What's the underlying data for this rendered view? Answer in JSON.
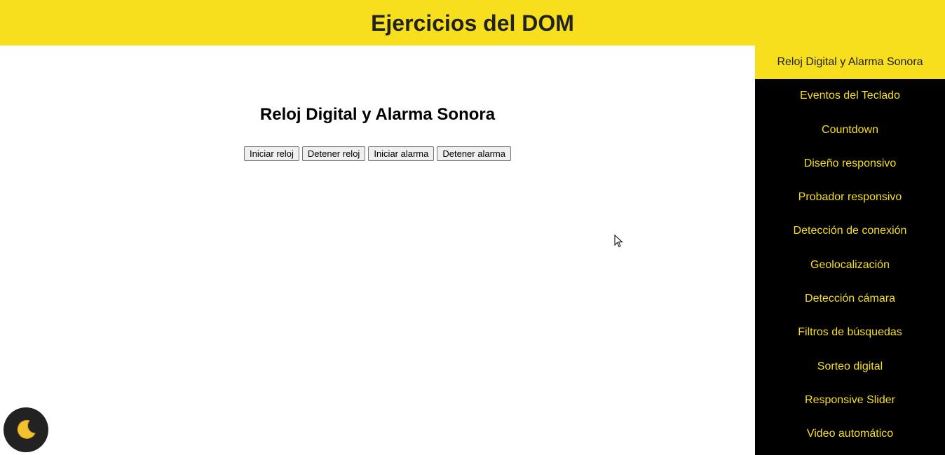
{
  "header": {
    "title": "Ejercicios del DOM"
  },
  "main": {
    "section_title": "Reloj Digital y Alarma Sonora",
    "buttons": {
      "start_clock": "Iniciar reloj",
      "stop_clock": "Detener reloj",
      "start_alarm": "Iniciar alarma",
      "stop_alarm": "Detener alarma"
    }
  },
  "sidebar": {
    "items": [
      {
        "label": "Reloj Digital y Alarma Sonora",
        "active": true
      },
      {
        "label": "Eventos del Teclado"
      },
      {
        "label": "Countdown"
      },
      {
        "label": "Diseño responsivo"
      },
      {
        "label": "Probador responsivo"
      },
      {
        "label": "Detección de conexión"
      },
      {
        "label": "Geolocalización"
      },
      {
        "label": "Detección cámara"
      },
      {
        "label": "Filtros de búsquedas"
      },
      {
        "label": "Sorteo digital"
      },
      {
        "label": "Responsive Slider"
      },
      {
        "label": "Video automático"
      }
    ]
  },
  "theme_toggle": {
    "icon": "moon-icon"
  },
  "colors": {
    "accent": "#f7df1e",
    "dark": "#222222",
    "sidebar_bg": "#000000"
  }
}
